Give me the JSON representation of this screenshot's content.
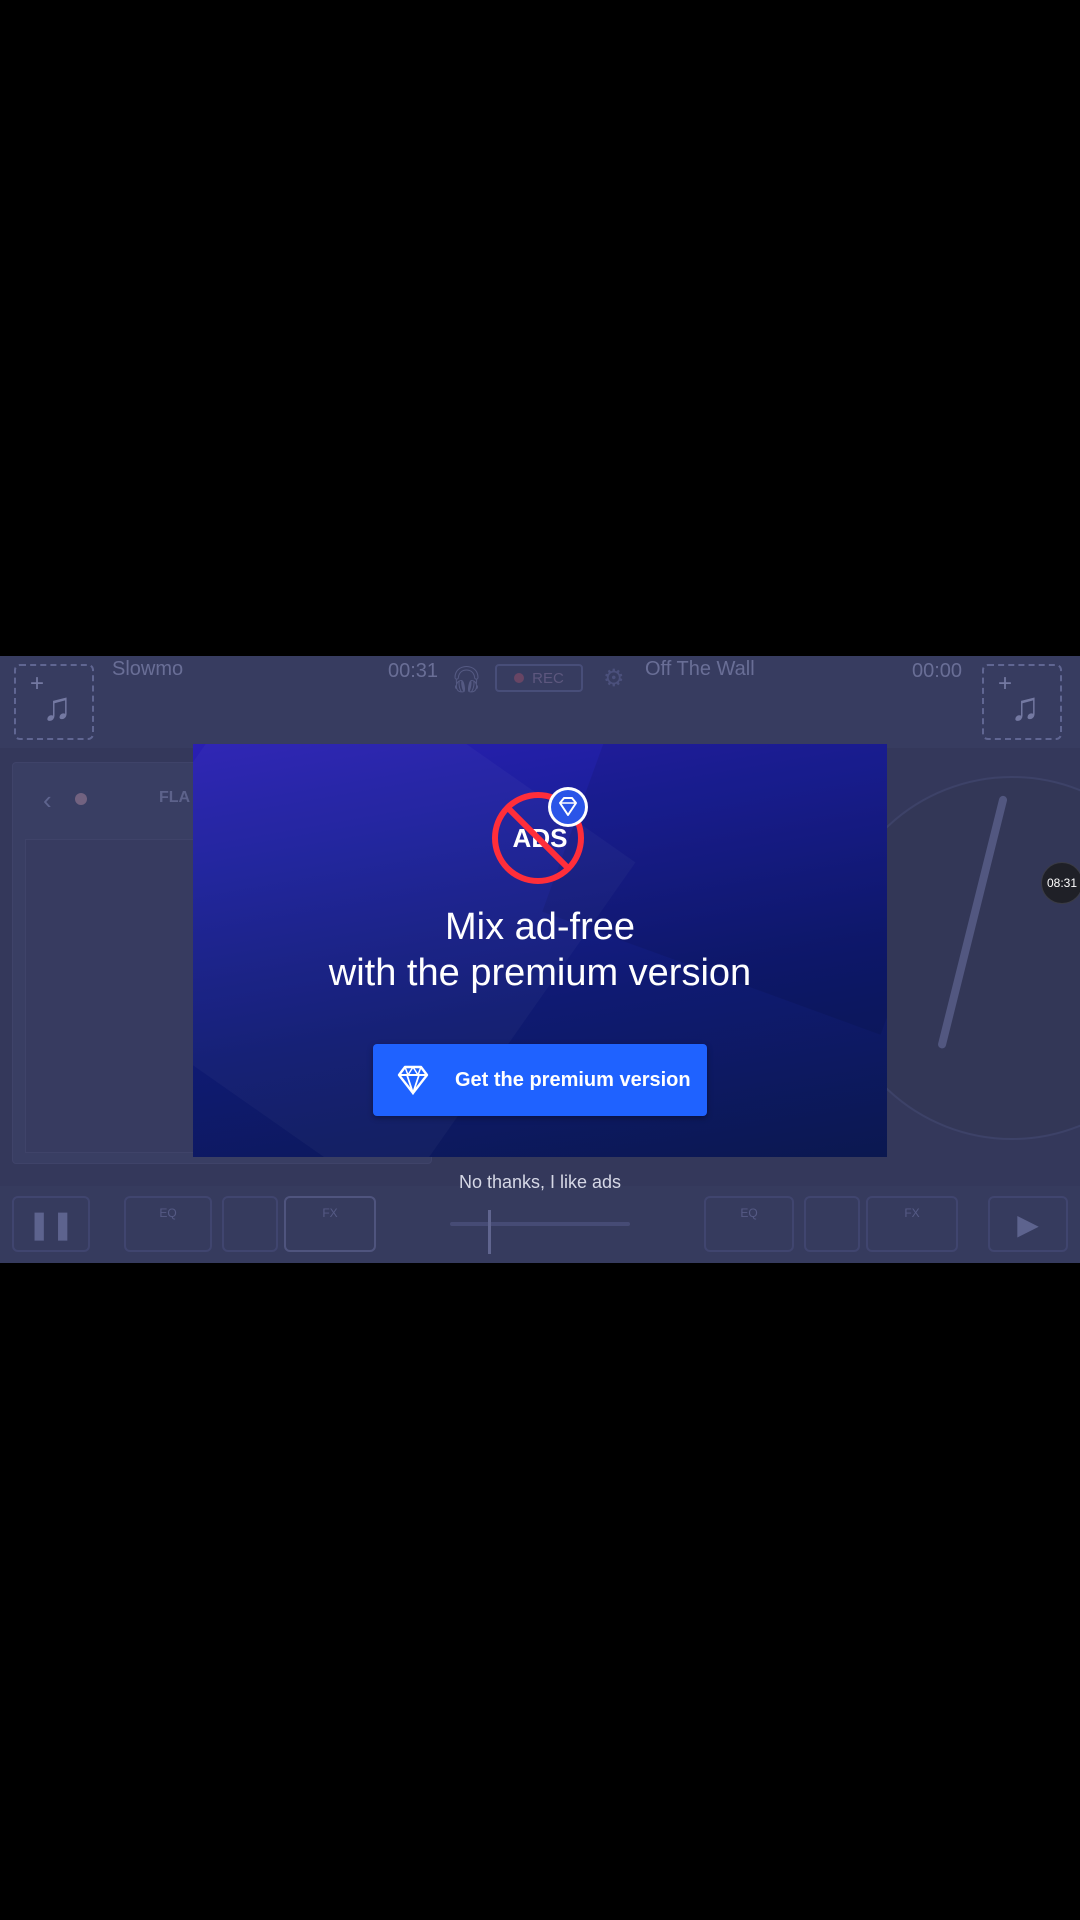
{
  "app": {
    "left_deck": {
      "track_title": "Slowmo",
      "time": "00:31"
    },
    "right_deck": {
      "track_title": "Off The Wall",
      "time": "00:00"
    },
    "rec_label": "REC",
    "panel_label": "FLA",
    "bottom_bar": {
      "left_eq": "EQ",
      "left_fx": "FX",
      "right_eq": "EQ",
      "right_fx": "FX"
    },
    "icons": {
      "add_music": "music-note-plus-icon",
      "headphones": "headphones-icon",
      "settings": "gear-icon",
      "pause": "pause-icon",
      "play": "play-icon"
    }
  },
  "modal": {
    "badge_text": "ADS",
    "headline_line1": "Mix ad-free",
    "headline_line2": "with the premium version",
    "cta_label": "Get the premium version",
    "cta_color": "#1f62ff",
    "decline_label": "No thanks, I like ads"
  },
  "timer_badge": "08:31"
}
